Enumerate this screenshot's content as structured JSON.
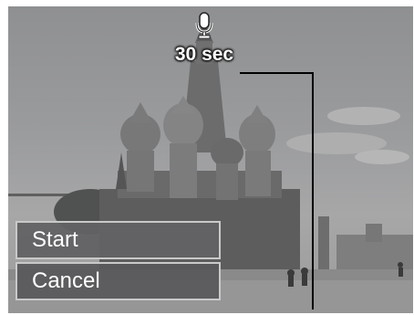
{
  "recording": {
    "icon": "microphone-icon",
    "duration_label": "30 sec"
  },
  "menu": {
    "items": [
      {
        "label": "Start",
        "selected": true
      },
      {
        "label": "Cancel",
        "selected": false
      }
    ]
  },
  "colors": {
    "menu_background": "#58585a",
    "menu_border": "#c9c9c9",
    "text": "#ffffff"
  }
}
